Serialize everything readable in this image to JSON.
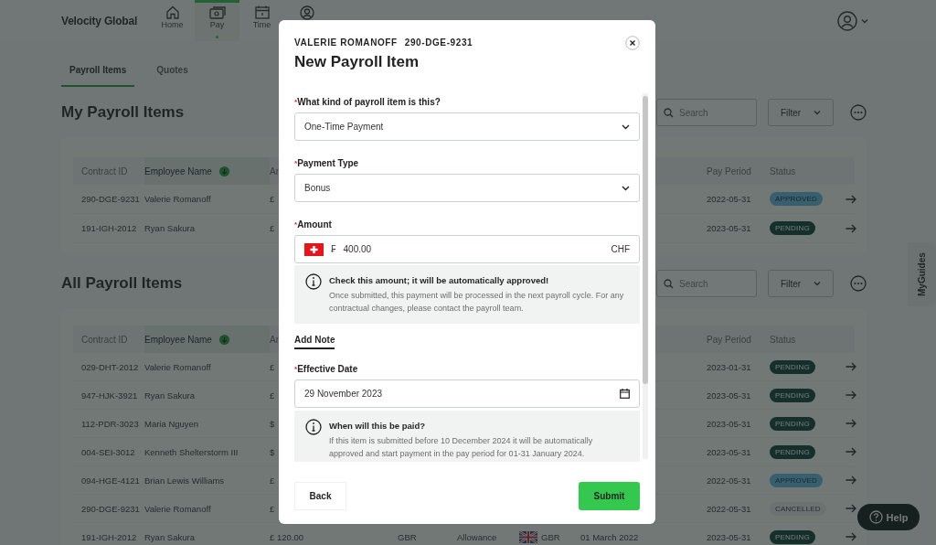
{
  "header": {
    "logo": "Velocity Global",
    "nav": [
      {
        "label": "Home",
        "selected": false
      },
      {
        "label": "Pay",
        "selected": true
      },
      {
        "label": "Time",
        "selected": false
      },
      {
        "selected": false
      }
    ]
  },
  "tabs": [
    {
      "label": "Payroll Items",
      "selected": true
    },
    {
      "label": "Quotes",
      "selected": false
    }
  ],
  "sections": [
    {
      "title": "My Payroll Items",
      "search": {
        "placeholder": "Search"
      },
      "filter": "Filter",
      "table": {
        "columns": [
          {
            "label": "Contract ID",
            "sorted": false
          },
          {
            "label": "Employee Name",
            "sorted": true
          },
          {
            "label": "Ar",
            "sorted": false
          },
          {
            "label": "Pay Period",
            "sorted": false
          },
          {
            "label": "Status",
            "sorted": false
          }
        ],
        "rows": [
          {
            "contract_id": "290-DGE-9231",
            "employee_name": "Valerie Romanoff",
            "amount": "£",
            "pay_period": "2022-05-31",
            "status": {
              "label": "APPROVED",
              "kind": "approved"
            }
          },
          {
            "contract_id": "191-IGH-2012",
            "employee_name": "Ryan Sakura",
            "amount": "£",
            "pay_period": "2023-05-31",
            "status": {
              "label": "PENDING",
              "kind": "pending"
            }
          }
        ]
      }
    },
    {
      "title": "All Payroll Items",
      "search": {
        "placeholder": "Search"
      },
      "filter": "Filter",
      "table": {
        "columns": [
          {
            "label": "Contract ID",
            "sorted": false
          },
          {
            "label": "Employee Name",
            "sorted": true
          },
          {
            "label": "Ar",
            "sorted": false
          },
          {
            "label": "Pay Period",
            "sorted": false
          },
          {
            "label": "Status",
            "sorted": false
          }
        ],
        "rows": [
          {
            "contract_id": "029-DHT-2012",
            "employee_name": "Valerie Romanoff",
            "amount": "£",
            "pay_period": "2023-01-31",
            "status": {
              "label": "PENDING",
              "kind": "pending"
            }
          },
          {
            "contract_id": "947-HJK-3921",
            "employee_name": "Ryan Sakura",
            "amount": "£",
            "pay_period": "2023-05-31",
            "status": {
              "label": "PENDING",
              "kind": "pending"
            }
          },
          {
            "contract_id": "112-PDR-3023",
            "employee_name": "Maria Nguyen",
            "amount": "$",
            "pay_period": "2023-05-31",
            "status": {
              "label": "PENDING",
              "kind": "pending"
            }
          },
          {
            "contract_id": "004-SEI-3012",
            "employee_name": "Kenneth Shelterstorm III",
            "amount": "$",
            "pay_period": "2023-05-31",
            "status": {
              "label": "PENDING",
              "kind": "pending"
            }
          },
          {
            "contract_id": "094-HGE-4121",
            "employee_name": "Brian Lewis Williams",
            "amount": "£",
            "pay_period": "2022-05-31",
            "status": {
              "label": "APPROVED",
              "kind": "approved"
            }
          },
          {
            "contract_id": "290-DGE-9231",
            "employee_name": "Valerie Romanoff",
            "amount": "£",
            "pay_period": "2022-05-31",
            "status": {
              "label": "CANCELLED",
              "kind": "cancelled"
            }
          },
          {
            "contract_id": "191-IGH-2012",
            "employee_name": "Ryan Sakura",
            "amount": "£ 120.00",
            "currency": "GBR",
            "type": "Allowance",
            "country": "GBR",
            "start_date": "01 March 2022",
            "pay_period": "2023-05-31",
            "status": {
              "label": "PENDING",
              "kind": "pending"
            }
          }
        ]
      }
    }
  ],
  "side_tab": "MyGuides",
  "help_button": "Help",
  "dialog": {
    "employee": "VALERIE ROMANOFF",
    "contract": "290-DGE-9231",
    "title": "New Payroll Item",
    "fields": [
      {
        "kind": "select",
        "required_mark": "*",
        "label": "What kind of payroll item is this?",
        "value": "One-Time Payment"
      },
      {
        "kind": "select",
        "required_mark": "*",
        "label": "Payment Type",
        "value": "Bonus"
      },
      {
        "kind": "amount",
        "required_mark": "*",
        "label": "Amount",
        "symbol": "₣",
        "value": "400.00",
        "currency": "CHF"
      },
      {
        "kind": "info",
        "title": "Check this amount; it will be automatically approved!",
        "text": "Once submitted, this payment will be processed in the next payroll cycle. For any contractual changes, please contact the payroll team."
      },
      {
        "kind": "link",
        "label": "Add Note"
      },
      {
        "kind": "date",
        "required_mark": "*",
        "label": "Effective Date",
        "value": "29 November 2023"
      },
      {
        "kind": "info",
        "title": "When will this be paid?",
        "text": "If this item is submitted before 10 December 2024 it will be automatically approved and start payment in the pay period for 01-31 January 2024."
      }
    ],
    "back": "Back",
    "submit": "Submit"
  }
}
